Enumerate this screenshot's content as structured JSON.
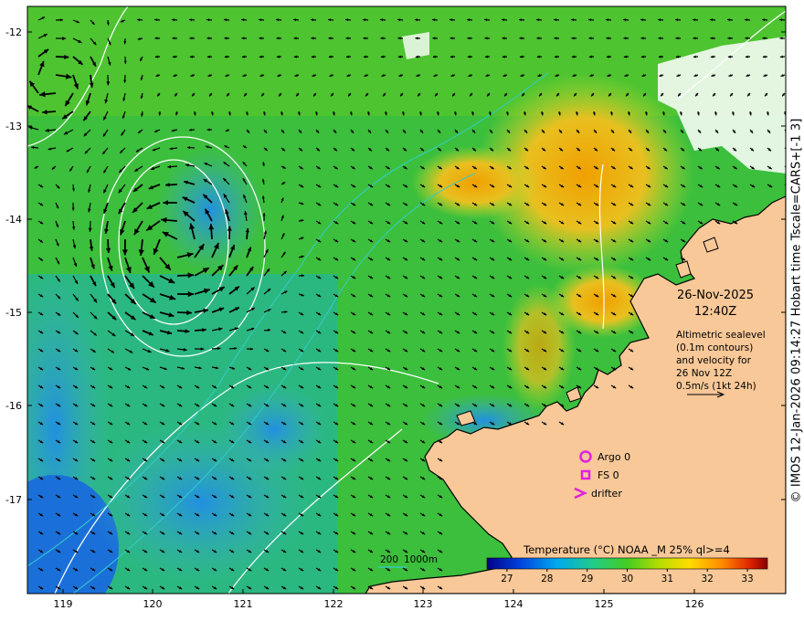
{
  "map": {
    "lat_labels": [
      "-12",
      "-13",
      "-14",
      "-15",
      "-16",
      "-17"
    ],
    "lon_labels": [
      "119",
      "120",
      "121",
      "122",
      "123",
      "124",
      "125",
      "126"
    ],
    "lat_range": [
      -17.95,
      -11.7
    ],
    "lon_range": [
      118.6,
      127.0
    ]
  },
  "datetime": {
    "date": "26-Nov-2025",
    "time": "12:40Z"
  },
  "notes": {
    "line1": "Altimetric sealevel",
    "line2": "(0.1m contours)",
    "line3": "and velocity for",
    "line4": "26 Nov 12Z",
    "line5": "0.5m/s (1kt 24h)"
  },
  "legend": {
    "argo": "Argo 0",
    "fs": "FS 0",
    "drifter": "drifter",
    "marker_color": "#e020e0"
  },
  "isobath": {
    "label_200": "200",
    "label_1000": "1000m",
    "color": "#33cccc"
  },
  "colorbar": {
    "title": "Temperature (°C) NOAA _M 25% ql>=4",
    "ticks": [
      "27",
      "28",
      "29",
      "30",
      "31",
      "32",
      "33"
    ],
    "range": [
      26.5,
      33.5
    ]
  },
  "credit": "© IMOS 12-Jan-2026 09:14:27 Hobart time Tscale=CARS+[-1 3]",
  "colors": {
    "land": "#f8c898",
    "cold": "#1050d0",
    "warm": "#f0a000"
  }
}
